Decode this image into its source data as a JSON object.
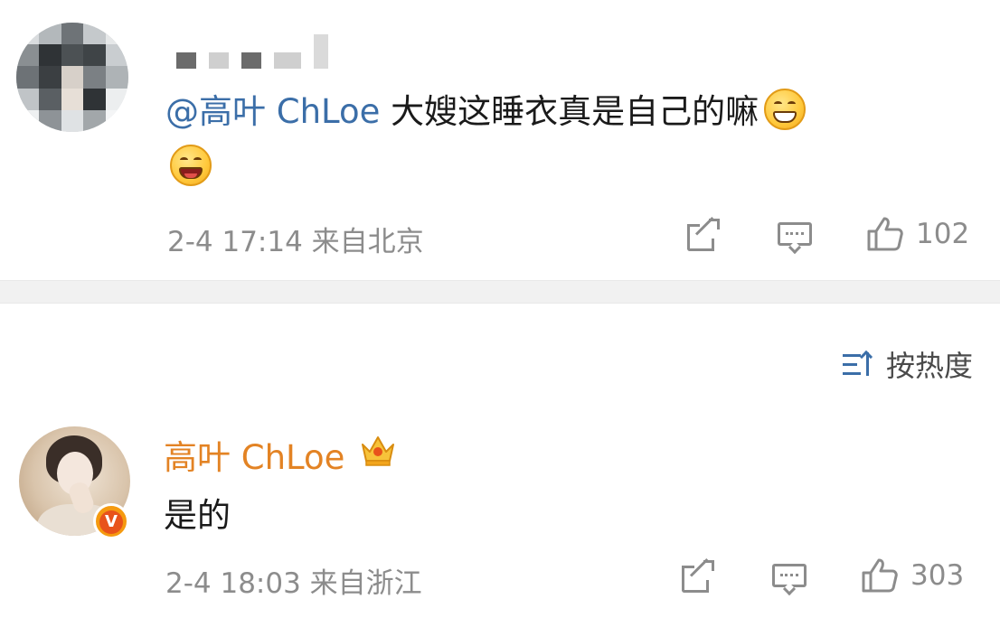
{
  "comment_1": {
    "author_masked": "",
    "text_mention": "@高叶 ChLoe",
    "text_body": " 大嫂这睡衣真是自己的嘛",
    "emoji_1": "grinning-emoji",
    "emoji_2": "laughing-emoji",
    "meta": "2-4 17:14 来自北京",
    "likes": "102"
  },
  "sort": {
    "label": "按热度",
    "icon": "sort-icon"
  },
  "comment_2": {
    "author": "高叶 ChLoe",
    "text": "是的",
    "meta": "2-4 18:03 来自浙江",
    "likes": "303",
    "badge_label": "V",
    "author_color": "#e38324"
  },
  "colors": {
    "mention": "#3b6ea8",
    "meta": "#8c8c8c",
    "divider": "#f1f1f1"
  }
}
